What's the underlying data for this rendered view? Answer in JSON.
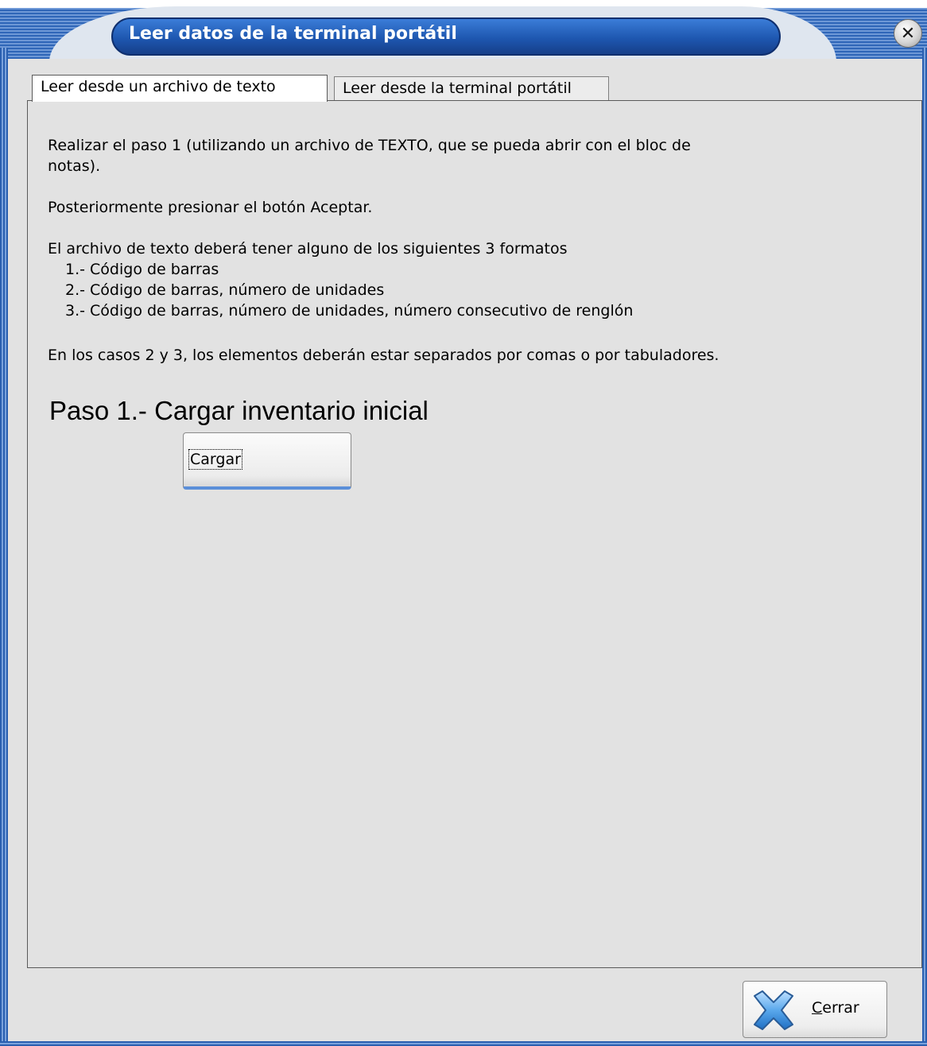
{
  "window": {
    "title": "Leer datos de la terminal portátil",
    "close_glyph": "✕"
  },
  "tabs": [
    {
      "label": "Leer desde un archivo de texto",
      "active": true
    },
    {
      "label": "Leer desde la terminal portátil",
      "active": false
    }
  ],
  "instructions": {
    "line1": "Realizar el paso 1 (utilizando un archivo de TEXTO, que se pueda abrir con el bloc de",
    "line2": "notas).",
    "line3": "Posteriormente presionar el botón Aceptar.",
    "line4": "El archivo de texto deberá tener alguno de los siguientes 3 formatos",
    "formats": [
      "1.- Código de barras",
      "2.- Código de barras, número de unidades",
      "3.- Código de barras, número de unidades, número consecutivo de renglón"
    ],
    "line5": "En los casos 2 y 3, los elementos deberán estar separados por comas o por tabuladores."
  },
  "step1": {
    "heading": "Paso 1.- Cargar inventario inicial",
    "button_label": "Cargar"
  },
  "footer": {
    "close_label_first": "C",
    "close_label_rest": "errar",
    "close_icon": "x-cross-icon"
  },
  "colors": {
    "title_bar": "#2f66b8",
    "title_pill": "#1e57b0",
    "client_bg": "#e2e2e2",
    "focus_accent": "#5b8fd9"
  }
}
